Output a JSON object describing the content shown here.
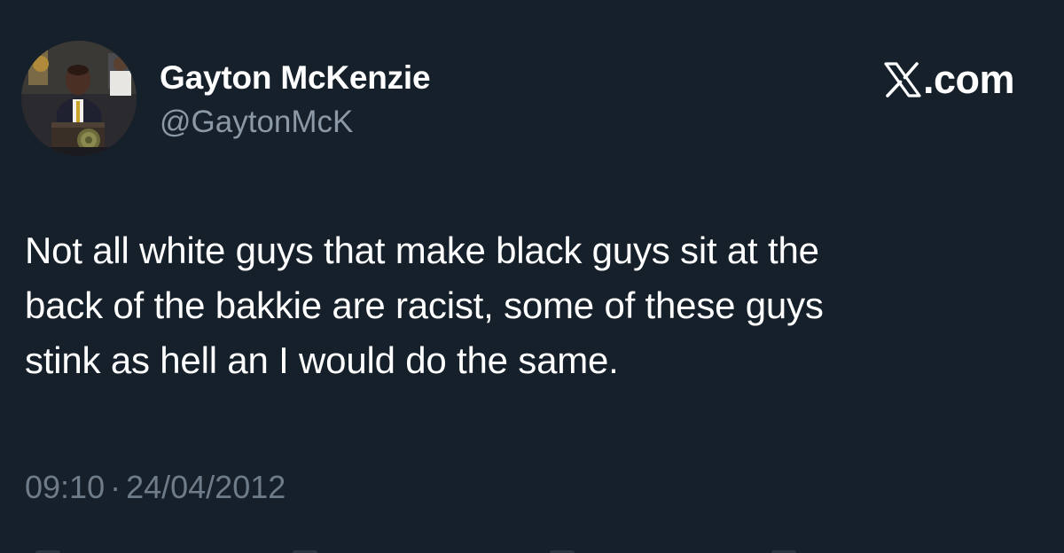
{
  "author": {
    "display_name": "Gayton McKenzie",
    "handle": "@GaytonMcK",
    "avatar_icon": "profile-photo-avatar"
  },
  "brand": {
    "logo_icon": "x-logo-icon",
    "text": ".com"
  },
  "tweet": {
    "lines": [
      "Not all white guys that make black guys sit at the",
      "back of the bakkie are racist, some of these guys",
      "stink as hell an I would do the same."
    ],
    "time": "09:10",
    "separator": "·",
    "date": "24/04/2012"
  },
  "colors": {
    "background": "#15202b",
    "primary_text": "#ffffff",
    "secondary_text": "#8b98a5",
    "timestamp_text": "#6e7c89"
  }
}
